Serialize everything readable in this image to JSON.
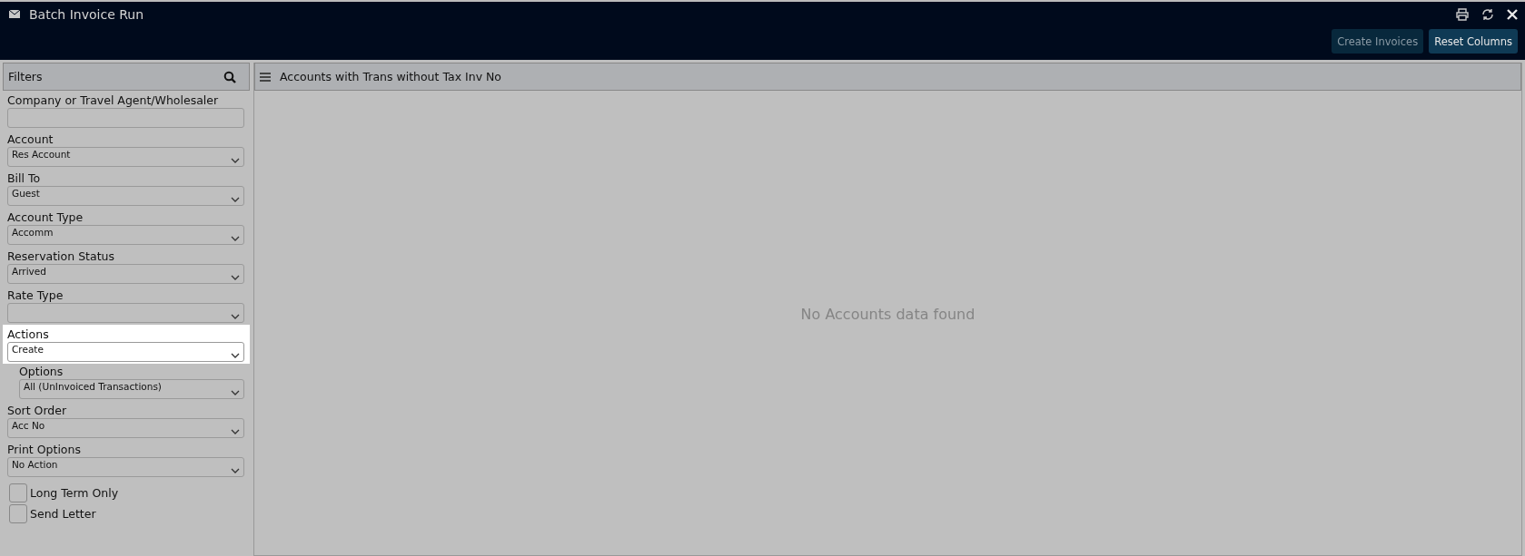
{
  "window": {
    "title": "Batch Invoice Run"
  },
  "toolbar": {
    "buttons": [
      {
        "label": "Create Invoices",
        "disabled": true
      },
      {
        "label": "Reset Columns",
        "disabled": false
      }
    ]
  },
  "filters": {
    "title": "Filters",
    "fields": [
      {
        "kind": "text",
        "label": "Company or Travel Agent/Wholesaler",
        "highlighted": false
      },
      {
        "kind": "select",
        "label": "Account",
        "value": "Res Account",
        "highlighted": false
      },
      {
        "kind": "select",
        "label": "Bill To",
        "value": "Guest",
        "highlighted": false
      },
      {
        "kind": "select",
        "label": "Account Type",
        "value": "Accomm",
        "highlighted": false
      },
      {
        "kind": "select",
        "label": "Reservation Status",
        "value": "Arrived",
        "highlighted": false
      },
      {
        "kind": "select",
        "label": "Rate Type",
        "highlighted": false
      },
      {
        "kind": "select",
        "label": "Actions",
        "value": "Create",
        "highlighted": true
      },
      {
        "kind": "subselect",
        "label": "Options",
        "value": "All (UnInvoiced Transactions)",
        "highlighted": false
      },
      {
        "kind": "select",
        "label": "Sort Order",
        "value": "Acc No",
        "highlighted": false
      },
      {
        "kind": "select",
        "label": "Print Options",
        "value": "No Action",
        "highlighted": false
      }
    ],
    "checkboxes": [
      {
        "label": "Long Term Only",
        "checked": false
      },
      {
        "label": "Send Letter",
        "checked": false
      }
    ]
  },
  "grid": {
    "title": "Accounts with Trans without Tax Inv No",
    "empty_message": "No Accounts data found"
  }
}
